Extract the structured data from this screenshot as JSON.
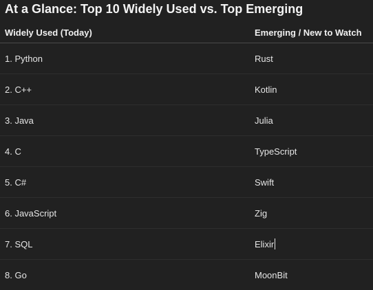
{
  "title": "At a Glance: Top 10 Widely Used vs. Top Emerging",
  "table": {
    "headers": [
      "Widely Used (Today)",
      "Emerging / New to Watch"
    ],
    "rows": [
      [
        "1. Python",
        "Rust"
      ],
      [
        "2. C++",
        "Kotlin"
      ],
      [
        "3. Java",
        "Julia"
      ],
      [
        "4. C",
        "TypeScript"
      ],
      [
        "5. C#",
        "Swift"
      ],
      [
        "6. JavaScript",
        "Zig"
      ],
      [
        "7. SQL",
        "Elixir"
      ],
      [
        "8. Go",
        "MoonBit"
      ]
    ]
  }
}
